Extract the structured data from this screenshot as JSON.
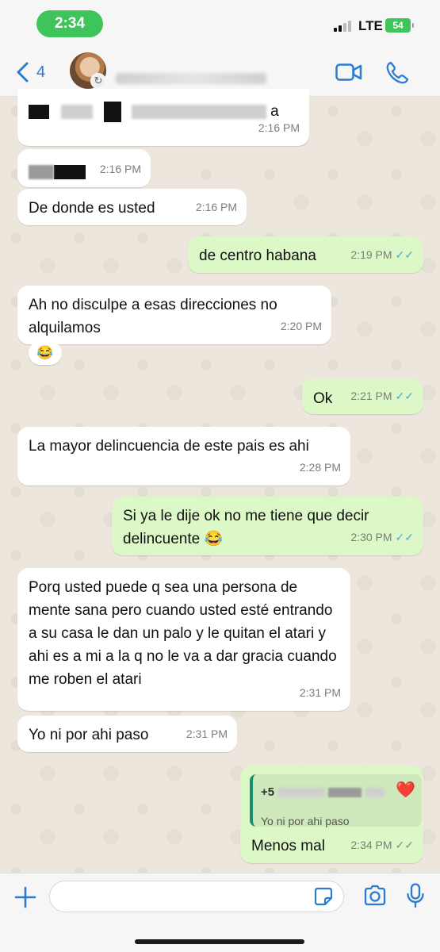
{
  "status_bar": {
    "time": "2:34",
    "network": "LTE",
    "battery": "54"
  },
  "header": {
    "back_count": "4"
  },
  "messages": [
    {
      "text": "a",
      "time": "2:16 PM"
    },
    {
      "time": "2:16 PM"
    },
    {
      "text": "De donde es usted",
      "time": "2:16 PM"
    },
    {
      "text": "de centro habana",
      "time": "2:19 PM"
    },
    {
      "text": "Ah no disculpe a esas direcciones no alquilamos",
      "time": "2:20 PM",
      "reaction": "😂"
    },
    {
      "text": "Ok",
      "time": "2:21 PM"
    },
    {
      "text": "La mayor delincuencia de este pais es ahi",
      "time": "2:28 PM"
    },
    {
      "text": "Si ya le dije ok no me tiene que decir delincuente 😂",
      "time": "2:30 PM"
    },
    {
      "text": "Porq usted puede q sea una persona de mente sana pero cuando usted esté entrando a su casa le dan un palo y le quitan el atari y ahi es a mi a la q no le va a dar gracia cuando me roben el atari",
      "time": "2:31 PM"
    },
    {
      "text": "Yo ni por ahi paso",
      "time": "2:31 PM"
    },
    {
      "text": "Menos mal",
      "time": "2:34 PM",
      "quote": {
        "sender_prefix": "+5",
        "text": "Yo ni por ahi paso",
        "reaction": "❤️"
      }
    }
  ],
  "ticks": "✓✓",
  "colors": {
    "accent": "#2b7bd0",
    "incoming": "#ffffff",
    "outgoing": "#dcf8c6",
    "read_ticks": "#4ea7e5",
    "status_green": "#3ec45a"
  },
  "icons": [
    "chevron-left-icon",
    "video-call-icon",
    "phone-icon",
    "plus-icon",
    "sticker-icon",
    "camera-icon",
    "microphone-icon"
  ]
}
